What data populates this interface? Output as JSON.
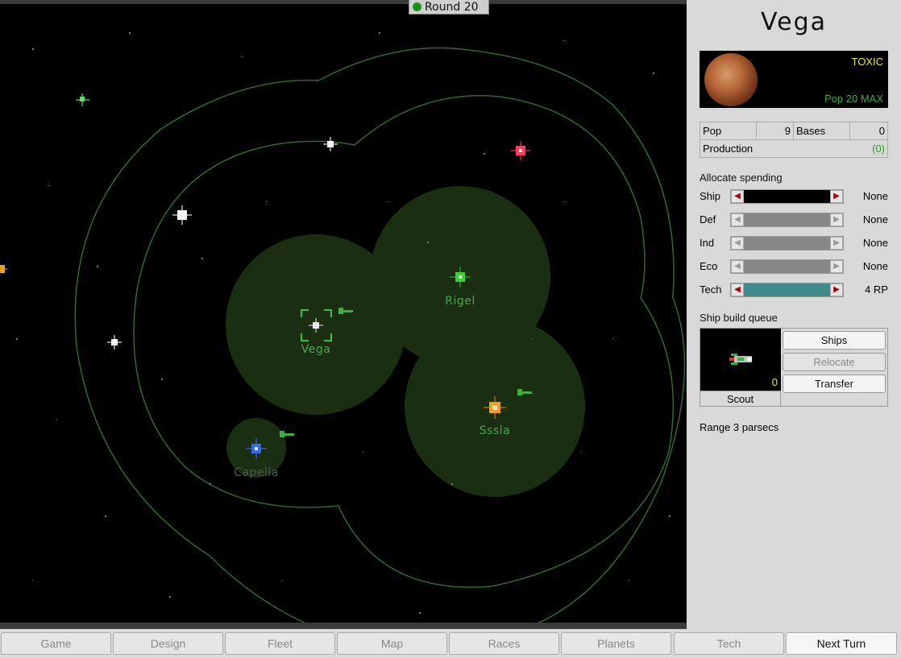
{
  "round": {
    "label": "Round 20"
  },
  "map": {
    "stars": [
      {
        "label": "Rigel",
        "owned": true
      },
      {
        "label": "Vega",
        "owned": true
      },
      {
        "label": "Sssla",
        "owned": true
      },
      {
        "label": "Capella",
        "owned": false
      }
    ]
  },
  "planet": {
    "name": "Vega",
    "environment": "TOXIC",
    "max_pop": "Pop 20 MAX",
    "stats": {
      "pop_label": "Pop",
      "pop_value": "9",
      "bases_label": "Bases",
      "bases_value": "0",
      "production_label": "Production",
      "production_value": "(0)"
    }
  },
  "allocation": {
    "title": "Allocate spending",
    "rows": [
      {
        "label": "Ship",
        "value": "None",
        "style": "black"
      },
      {
        "label": "Def",
        "value": "None",
        "style": "grey"
      },
      {
        "label": "Ind",
        "value": "None",
        "style": "grey"
      },
      {
        "label": "Eco",
        "value": "None",
        "style": "grey"
      },
      {
        "label": "Tech",
        "value": "4 RP",
        "style": "teal"
      }
    ]
  },
  "queue": {
    "title": "Ship build queue",
    "ship_name": "Scout",
    "ship_count": "0",
    "buttons": {
      "ships": "Ships",
      "relocate": "Relocate",
      "transfer": "Transfer"
    }
  },
  "range": "Range 3 parsecs",
  "nav": {
    "items": [
      "Game",
      "Design",
      "Fleet",
      "Map",
      "Races",
      "Planets",
      "Tech",
      "Next Turn"
    ]
  },
  "colors": {
    "territory": "#1a2e12",
    "range_line": "#2f6a2a",
    "label_green": "#4ca84c",
    "accent_yellow": "#e8e83a"
  }
}
